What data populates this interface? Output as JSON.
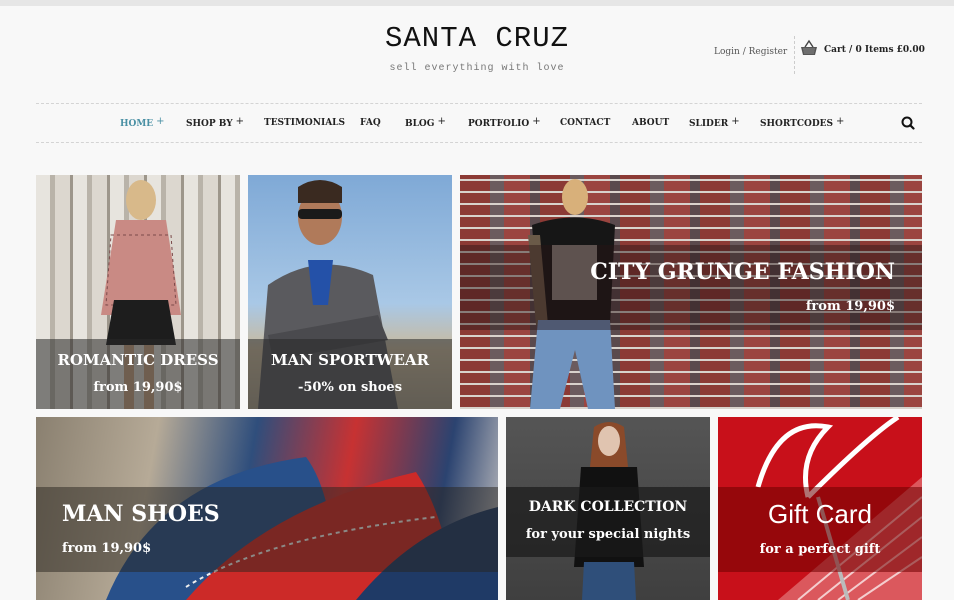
{
  "header": {
    "logo_title": "SANTA CRUZ",
    "logo_tagline": "sell everything with love",
    "account_link": "Login / Register",
    "cart_label": "Cart / 0 Items £0.00",
    "cart_icon": "basket-icon"
  },
  "nav": {
    "items": [
      {
        "label": "HOME",
        "has_submenu": true,
        "active": true
      },
      {
        "label": "SHOP BY",
        "has_submenu": true,
        "active": false
      },
      {
        "label": "TESTIMONIALS",
        "has_submenu": false,
        "active": false
      },
      {
        "label": "FAQ",
        "has_submenu": false,
        "active": false
      },
      {
        "label": "BLOG",
        "has_submenu": true,
        "active": false
      },
      {
        "label": "PORTFOLIO",
        "has_submenu": true,
        "active": false
      },
      {
        "label": "CONTACT",
        "has_submenu": false,
        "active": false
      },
      {
        "label": "ABOUT",
        "has_submenu": false,
        "active": false
      },
      {
        "label": "SLIDER",
        "has_submenu": true,
        "active": false
      },
      {
        "label": "SHORTCODES",
        "has_submenu": true,
        "active": false
      }
    ],
    "submenu_marker": "+",
    "search_icon": "search-icon",
    "active_color": "#4a90a4"
  },
  "banners": [
    {
      "title": "ROMANTIC DRESS",
      "subtitle": "from 19,90$"
    },
    {
      "title": "MAN SPORTWEAR",
      "subtitle": "-50% on shoes"
    },
    {
      "title": "CITY GRUNGE FASHION",
      "subtitle": "from 19,90$"
    },
    {
      "title": "MAN SHOES",
      "subtitle": "from 19,90$"
    },
    {
      "title": "DARK COLLECTION",
      "subtitle": "for your special nights"
    },
    {
      "title": "Gift Card",
      "subtitle": "for a perfect gift"
    }
  ]
}
